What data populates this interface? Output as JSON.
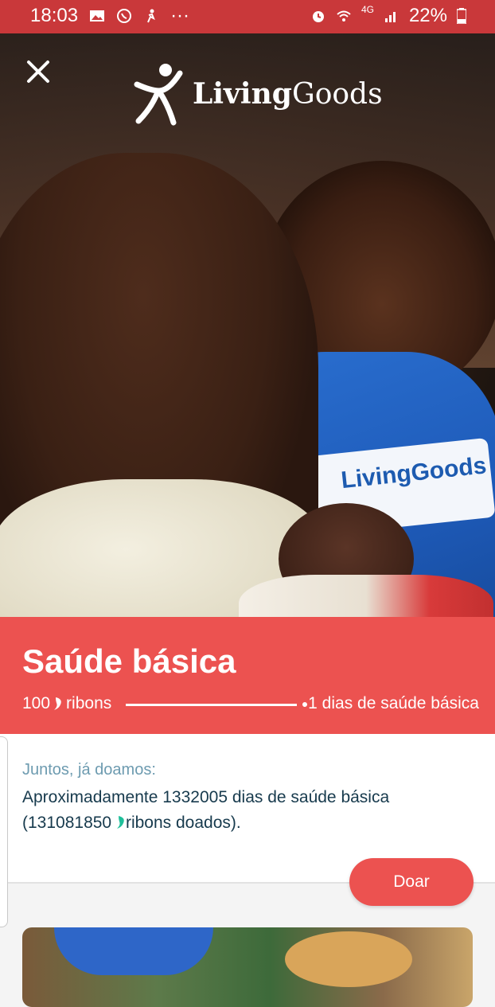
{
  "status_bar": {
    "time": "18:03",
    "more": "···",
    "network": "4G",
    "battery": "22%",
    "left_icons": [
      "image-icon",
      "whatsapp-icon",
      "running-icon"
    ],
    "right_icons": [
      "alarm-icon",
      "wifi-icon",
      "signal-icon",
      "battery-icon"
    ]
  },
  "hero": {
    "logo_text_bold": "Living",
    "logo_text_regular": "Goods",
    "badge_text": "LivingGoods"
  },
  "cause": {
    "title": "Saúde básica",
    "cost_amount": "100",
    "cost_unit": "ribons",
    "result": "1 dias de saúde básica"
  },
  "stats": {
    "label": "Juntos, já doamos:",
    "line1": "Aproximadamente 1332005 dias de saúde básica",
    "line2_prefix": "(131081850 ",
    "line2_suffix": "ribons doados)."
  },
  "actions": {
    "donate_label": "Doar"
  },
  "colors": {
    "status_bar": "#c9383a",
    "brand_red": "#ec5250",
    "ribbon_teal": "#1fbf9a",
    "label_blue": "#6d9bb0",
    "text_dark": "#173a4d"
  }
}
